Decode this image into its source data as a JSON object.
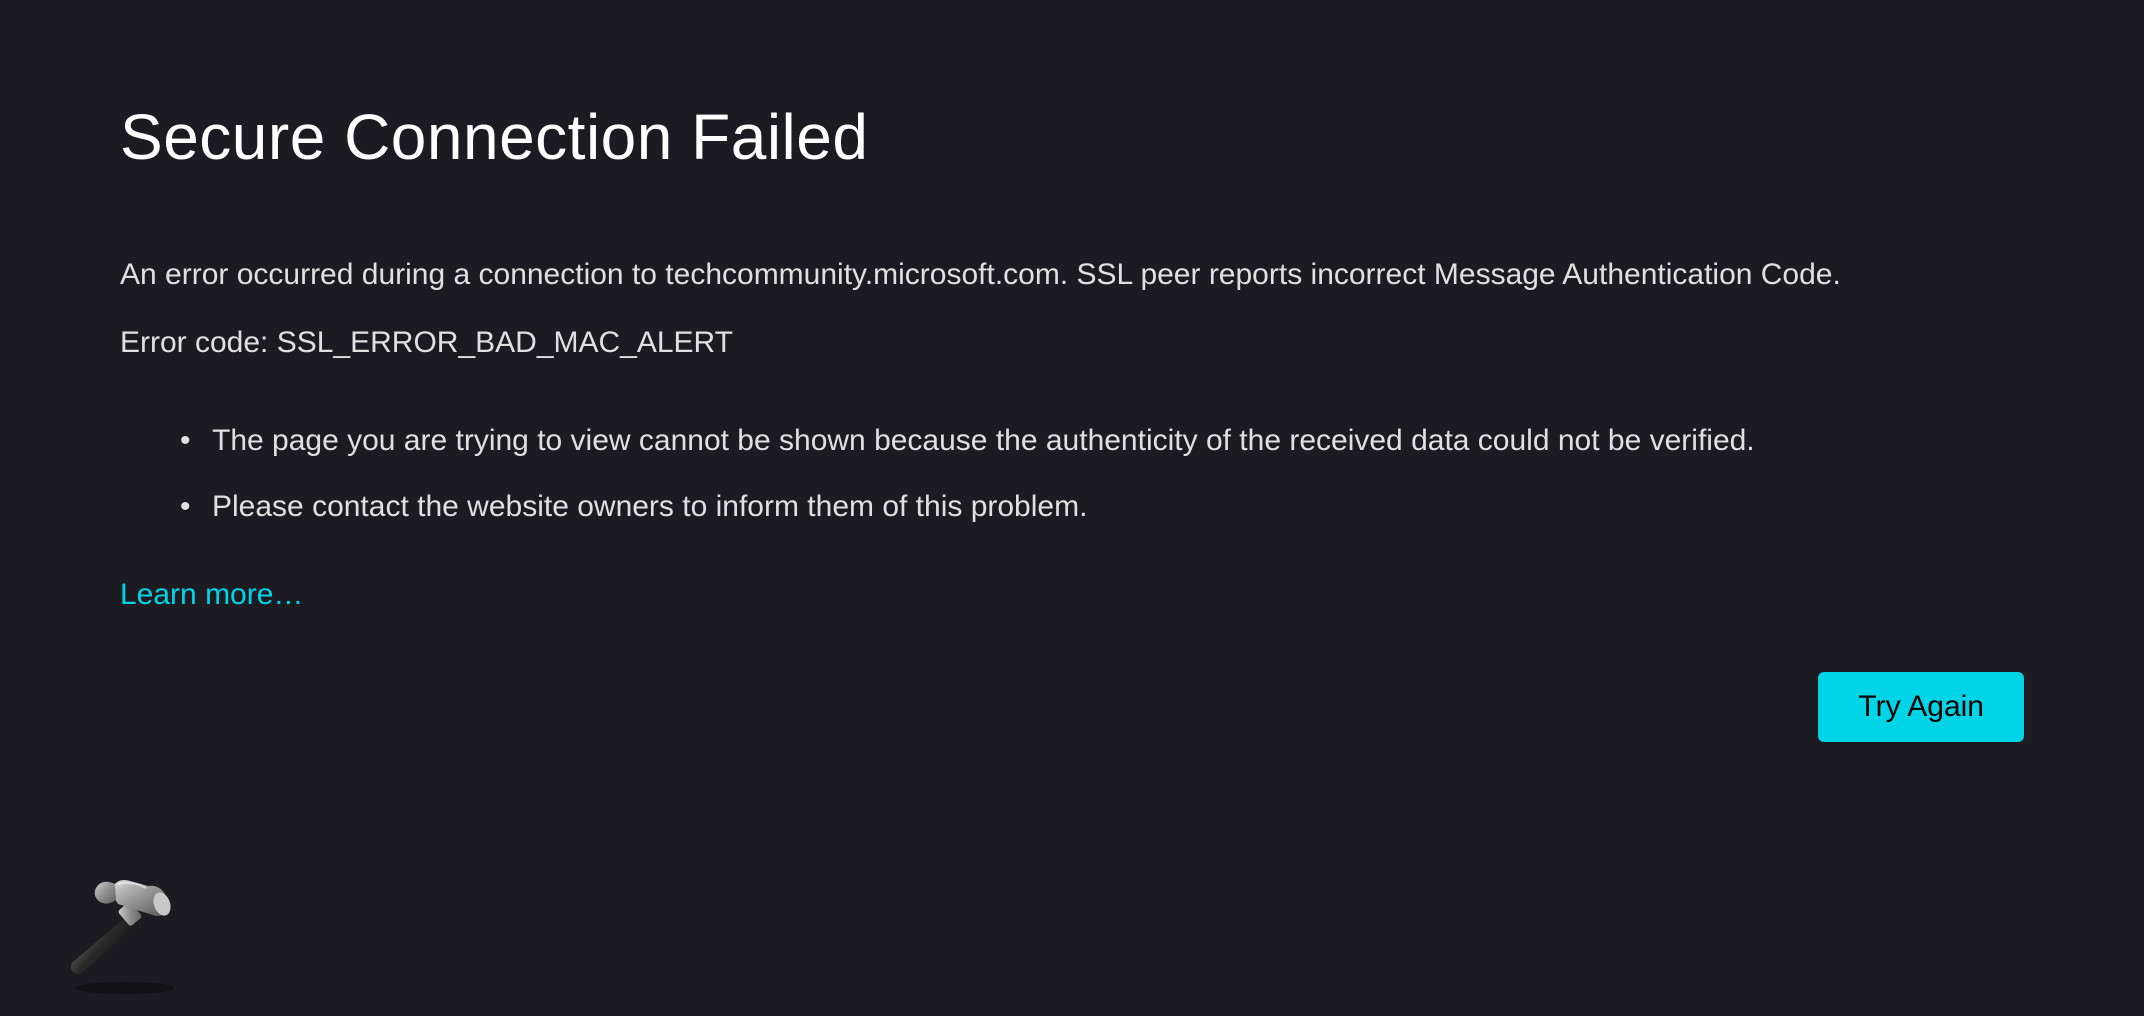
{
  "title": "Secure Connection Failed",
  "error_description": "An error occurred during a connection to techcommunity.microsoft.com. SSL peer reports incorrect Message Authentication Code.",
  "error_code_line": "Error code: SSL_ERROR_BAD_MAC_ALERT",
  "bullets": [
    "The page you are trying to view cannot be shown because the authenticity of the received data could not be verified.",
    "Please contact the website owners to inform them of this problem."
  ],
  "learn_more_label": "Learn more…",
  "try_again_label": "Try Again"
}
